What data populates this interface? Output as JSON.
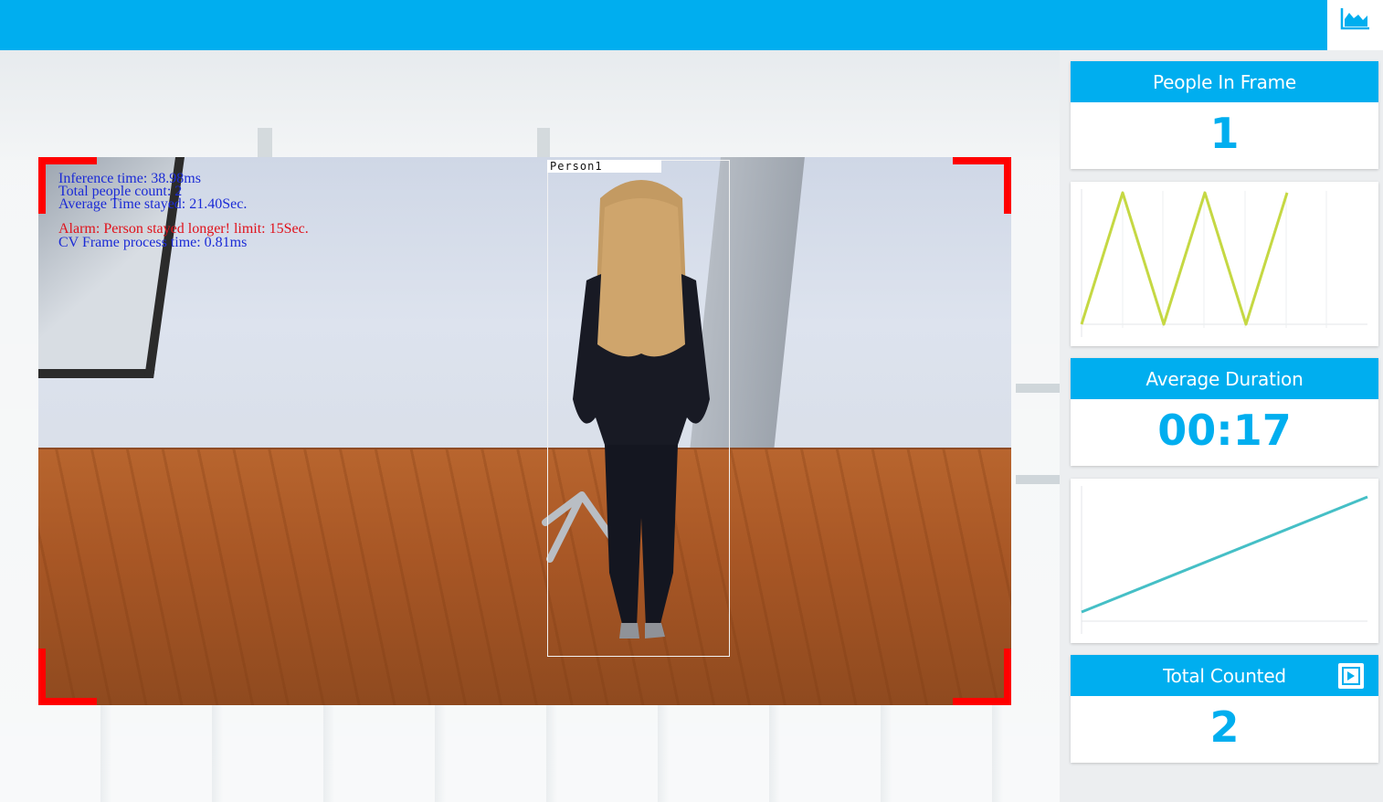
{
  "header": {
    "chart_toggle_icon": "area-chart-icon",
    "accent_color": "#00aeef"
  },
  "video": {
    "overlay_lines": [
      {
        "text": "Inference time: 38.98ms",
        "color": "#1b2bd6"
      },
      {
        "text": "Total people count: 2",
        "color": "#1b2bd6"
      },
      {
        "text": "Average Time stayed: 21.40Sec.",
        "color": "#1b2bd6"
      },
      {
        "text": "Alarm: Person stayed longer! limit: 15Sec.",
        "color": "#e0121b"
      },
      {
        "text": "CV Frame process time: 0.81ms",
        "color": "#1b2bd6"
      }
    ],
    "detection_label": "Person1",
    "corner_color": "#ff0000"
  },
  "sidebar": {
    "people_in_frame": {
      "title": "People In Frame",
      "value": "1"
    },
    "average_duration": {
      "title": "Average Duration",
      "value": "00:17"
    },
    "total_counted": {
      "title": "Total Counted",
      "value": "2",
      "action_icon": "play-icon"
    }
  },
  "chart_data": [
    {
      "type": "line",
      "title": "",
      "series": [
        {
          "values": [
            0,
            1,
            0,
            1,
            0,
            1
          ],
          "color": "#c5d843"
        }
      ],
      "ylim": [
        0,
        1
      ],
      "grid": true
    },
    {
      "type": "line",
      "title": "",
      "series": [
        {
          "values": [
            0,
            1
          ],
          "color": "#45bfc6"
        }
      ],
      "ylim": [
        0,
        1
      ],
      "grid": false
    }
  ]
}
